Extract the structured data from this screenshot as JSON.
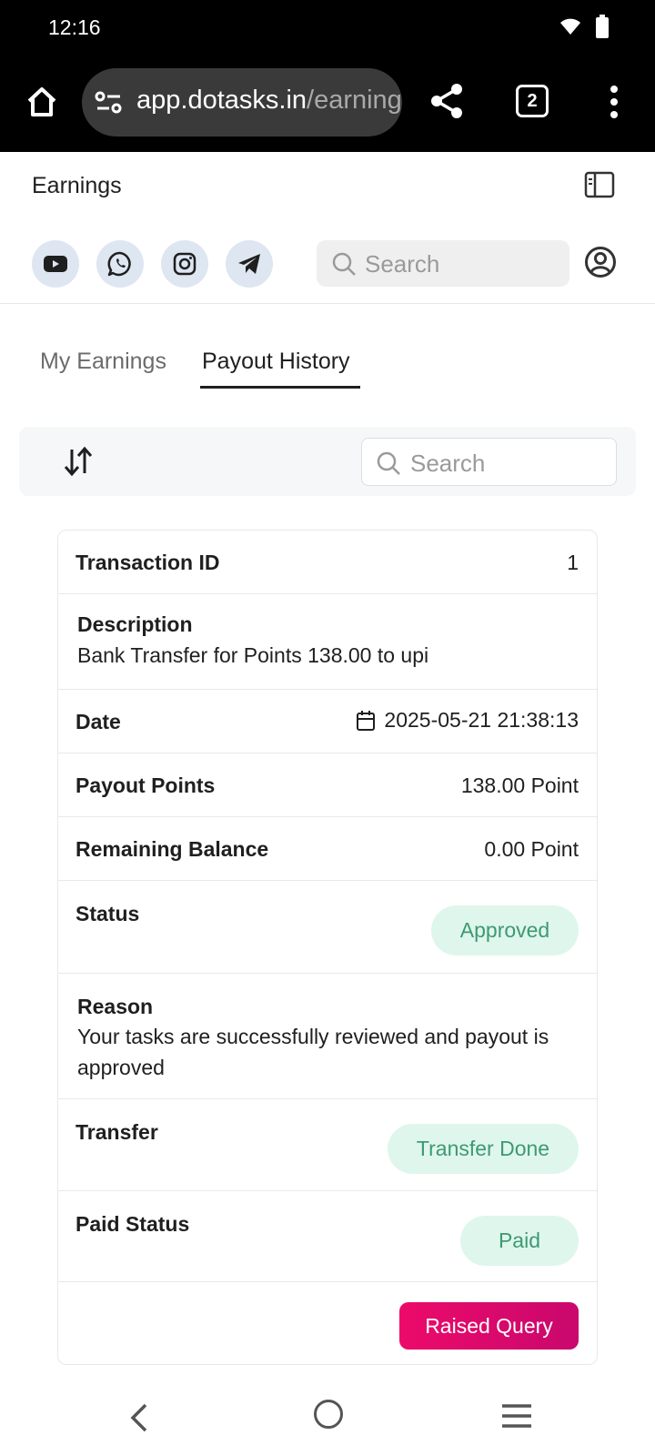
{
  "status_bar": {
    "time": "12:16"
  },
  "browser": {
    "url_host": "app.dotasks.in",
    "url_rest": "/earnings",
    "tab_count": "2"
  },
  "header": {
    "title": "Earnings",
    "search_placeholder": "Search"
  },
  "social_links": [
    {
      "name": "youtube-icon"
    },
    {
      "name": "whatsapp-icon"
    },
    {
      "name": "instagram-icon"
    },
    {
      "name": "telegram-icon"
    }
  ],
  "tabs": [
    {
      "label": "My Earnings",
      "active": false
    },
    {
      "label": "Payout History",
      "active": true
    }
  ],
  "filter": {
    "search_placeholder": "Search"
  },
  "transaction": {
    "id_label": "Transaction ID",
    "id_value": "1",
    "description_label": "Description",
    "description_value": "Bank Transfer for Points 138.00 to upi",
    "date_label": "Date",
    "date_value": "2025-05-21 21:38:13",
    "payout_label": "Payout Points",
    "payout_value": "138.00 Point",
    "balance_label": "Remaining Balance",
    "balance_value": "0.00 Point",
    "status_label": "Status",
    "status_value": "Approved",
    "reason_label": "Reason",
    "reason_value": "Your tasks are successfully reviewed and payout is approved",
    "transfer_label": "Transfer",
    "transfer_value": "Transfer Done",
    "paid_label": "Paid Status",
    "paid_value": "Paid",
    "query_button": "Raised Query"
  },
  "colors": {
    "accent": "#ec0a6a",
    "status_pill_bg": "#dff6ec",
    "status_pill_text": "#3d9a72",
    "social_bg": "#dde6f1"
  }
}
